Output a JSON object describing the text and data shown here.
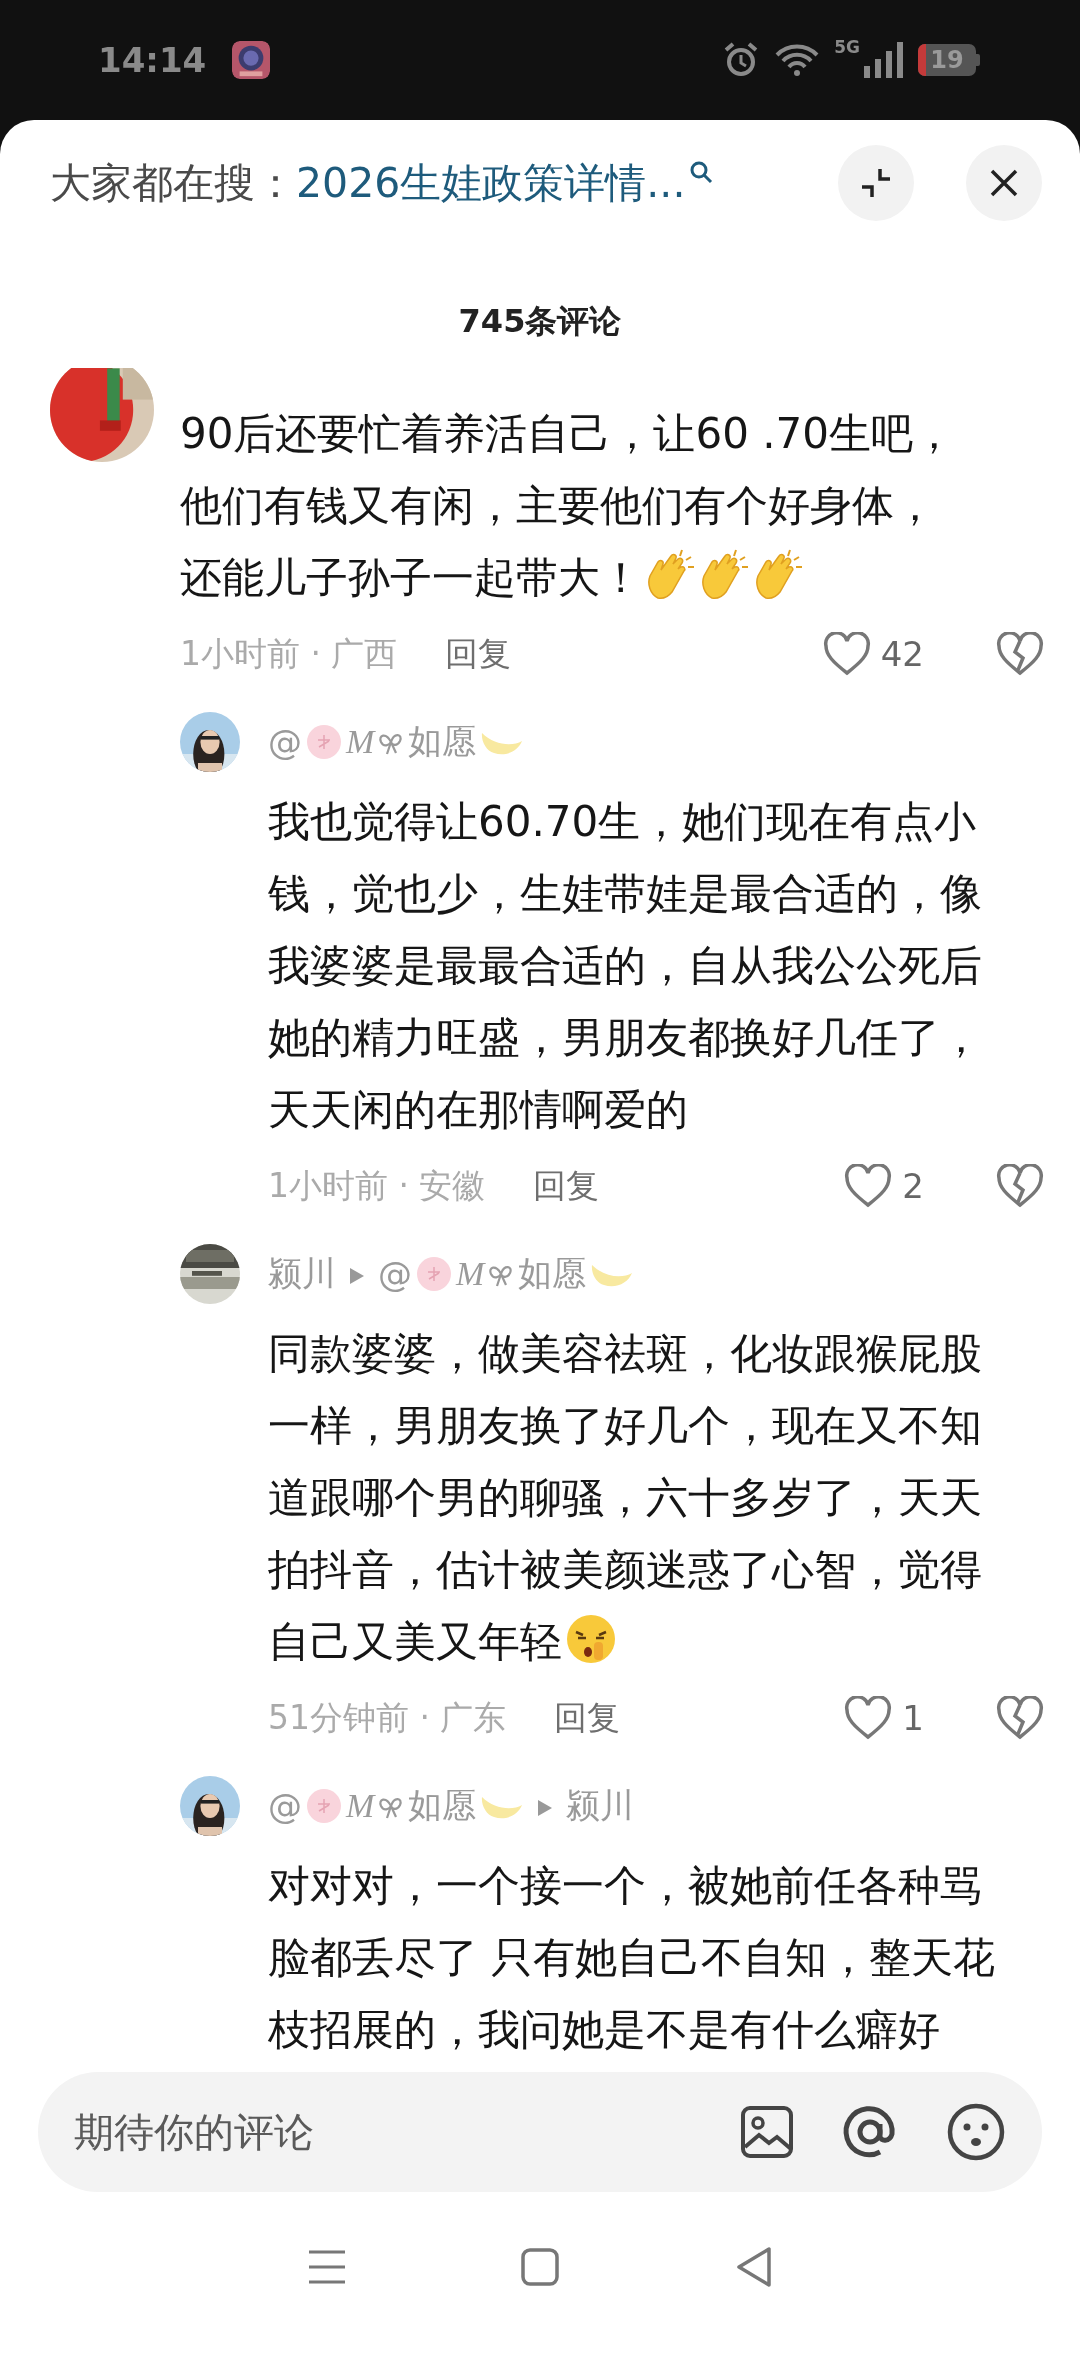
{
  "status_bar": {
    "time": "14:14",
    "network": "5G",
    "battery": "19"
  },
  "header": {
    "label": "大家都在搜：",
    "query": "2026生娃政策详情..."
  },
  "comments_title": "745条评论",
  "comments": [
    {
      "kind": "top",
      "text": "90后还要忙着养活自己，让60 .70生吧，他们有钱又有闲，主要他们有个好身体，还能儿子孙子一起带大！",
      "emoji": [
        {
          "kind": "clap"
        },
        {
          "kind": "clap"
        },
        {
          "kind": "clap"
        }
      ],
      "time": "1小时前 · 广西",
      "reply": "回复",
      "likes": "42"
    },
    {
      "kind": "reply",
      "author": {
        "prefix": "@",
        "letter": "M",
        "name": "如愿"
      },
      "text": "我也觉得让60.70生，她们现在有点小钱，觉也少，生娃带娃是最合适的，像我婆婆是最最合适的，自从我公公死后她的精力旺盛，男朋友都换好几任了，天天闲的在那情啊爱的",
      "time": "1小时前 · 安徽",
      "reply": "回复",
      "likes": "2"
    },
    {
      "kind": "reply",
      "author": {
        "name": "颍川"
      },
      "target": {
        "prefix": "@",
        "letter": "M",
        "name": "如愿"
      },
      "text": "同款婆婆，做美容祛斑，化妆跟猴屁股一样，男朋友换了好几个，现在又不知道跟哪个男的聊骚，六十多岁了，天天拍抖音，估计被美颜迷惑了心智，觉得自己又美又年轻",
      "emoji": [
        {
          "kind": "shush"
        }
      ],
      "time": "51分钟前 · 广东",
      "reply": "回复",
      "likes": "1"
    },
    {
      "kind": "reply",
      "author": {
        "prefix": "@",
        "letter": "M",
        "name": "如愿"
      },
      "target": {
        "name": "颍川"
      },
      "text": "对对对，一个接一个，被她前任各种骂脸都丢尽了 只有她自己不自知，整天花枝招展的，我问她是不是有什么癖好"
    }
  ],
  "comment_input": {
    "placeholder": "期待你的评论"
  }
}
